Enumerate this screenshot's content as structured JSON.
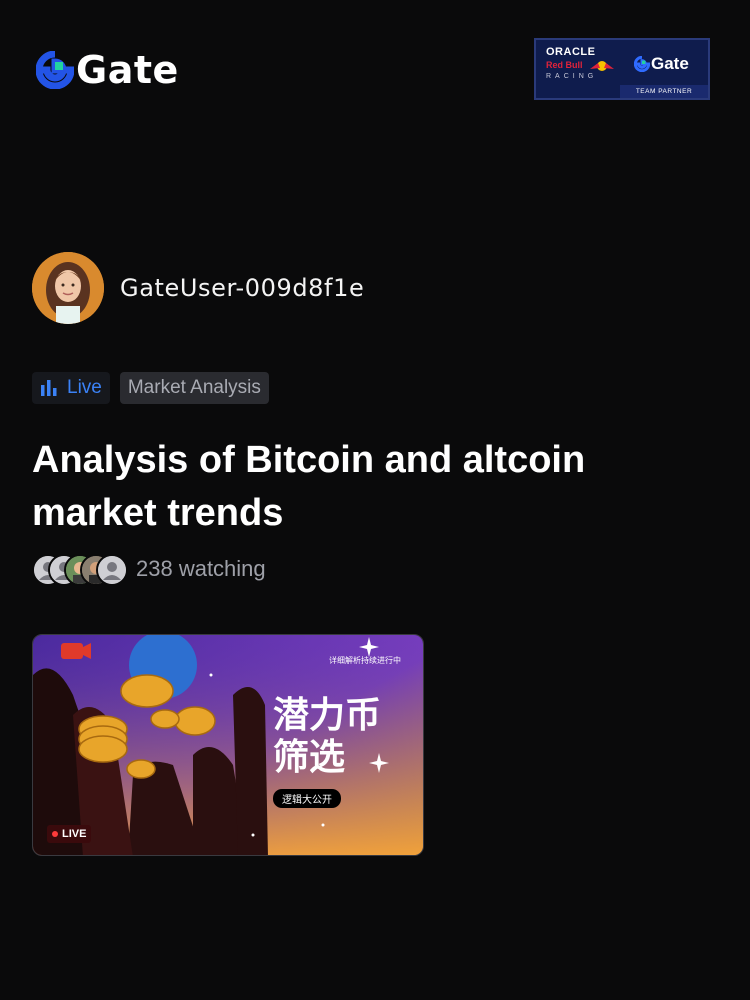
{
  "brand": {
    "logo_text": "Gate",
    "partner": {
      "oracle": "ORACLE",
      "redbull": "Red Bull",
      "racing": "RACING",
      "gate": "Gate",
      "team_partner": "TEAM PARTNER"
    }
  },
  "user": {
    "name": "GateUser-009d8f1e",
    "avatar_icon": "user-avatar-photo"
  },
  "tags": {
    "live_label": "Live",
    "category": "Market Analysis"
  },
  "stream": {
    "title": "Analysis of Bitcoin and altcoin market trends",
    "watching": "238 watching",
    "thumbnail": {
      "live_badge": "LIVE",
      "top_text": "详细解析持续进行中",
      "headline_line1": "潜力币",
      "headline_line2": "筛选",
      "pill_text": "逻辑大公开"
    }
  },
  "colors": {
    "background": "#0a0a0b",
    "accent_blue": "#3b82f6",
    "logo_green": "#22d3a0",
    "live_red": "#ff3b3b"
  }
}
